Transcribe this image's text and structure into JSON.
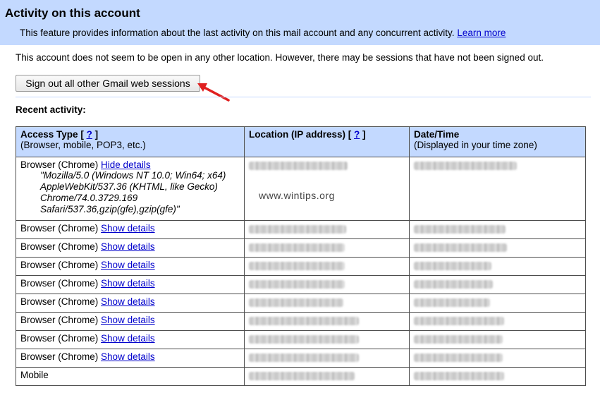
{
  "header": {
    "title": "Activity on this account",
    "description": "This feature provides information about the last activity on this mail account and any concurrent activity.",
    "learn_more": "Learn more"
  },
  "notice": "This account does not seem to be open in any other location. However, there may be sessions that have not been signed out.",
  "signout_button": "Sign out all other Gmail web sessions",
  "recent_activity_label": "Recent activity:",
  "table": {
    "columns": [
      {
        "title": "Access Type",
        "help_open": "[ ",
        "help": "?",
        "help_close": " ]",
        "sub": "(Browser, mobile, POP3, etc.)"
      },
      {
        "title": "Location (IP address)",
        "help_open": "[ ",
        "help": "?",
        "help_close": " ]",
        "sub": ""
      },
      {
        "title": "Date/Time",
        "help_open": "",
        "help": "",
        "help_close": "",
        "sub": "(Displayed in your time zone)"
      }
    ],
    "rows": [
      {
        "type": "Browser (Chrome)",
        "toggle": "Hide details",
        "ua_1": "\"Mozilla/5.0 (Windows NT 10.0; Win64; x64)",
        "ua_2": "AppleWebKit/537.36 (KHTML, like Gecko)",
        "ua_3": "Chrome/74.0.3729.169",
        "ua_4": "Safari/537.36,gzip(gfe),gzip(gfe)\""
      },
      {
        "type": "Browser (Chrome)",
        "toggle": "Show details"
      },
      {
        "type": "Browser (Chrome)",
        "toggle": "Show details"
      },
      {
        "type": "Browser (Chrome)",
        "toggle": "Show details"
      },
      {
        "type": "Browser (Chrome)",
        "toggle": "Show details"
      },
      {
        "type": "Browser (Chrome)",
        "toggle": "Show details"
      },
      {
        "type": "Browser (Chrome)",
        "toggle": "Show details"
      },
      {
        "type": "Browser (Chrome)",
        "toggle": "Show details"
      },
      {
        "type": "Browser (Chrome)",
        "toggle": "Show details"
      },
      {
        "type": "Mobile",
        "toggle": ""
      }
    ]
  },
  "watermark": "www.wintips.org",
  "colors": {
    "header_bg": "#c3d9ff",
    "link": "#0000cc",
    "arrow": "#e02020"
  }
}
